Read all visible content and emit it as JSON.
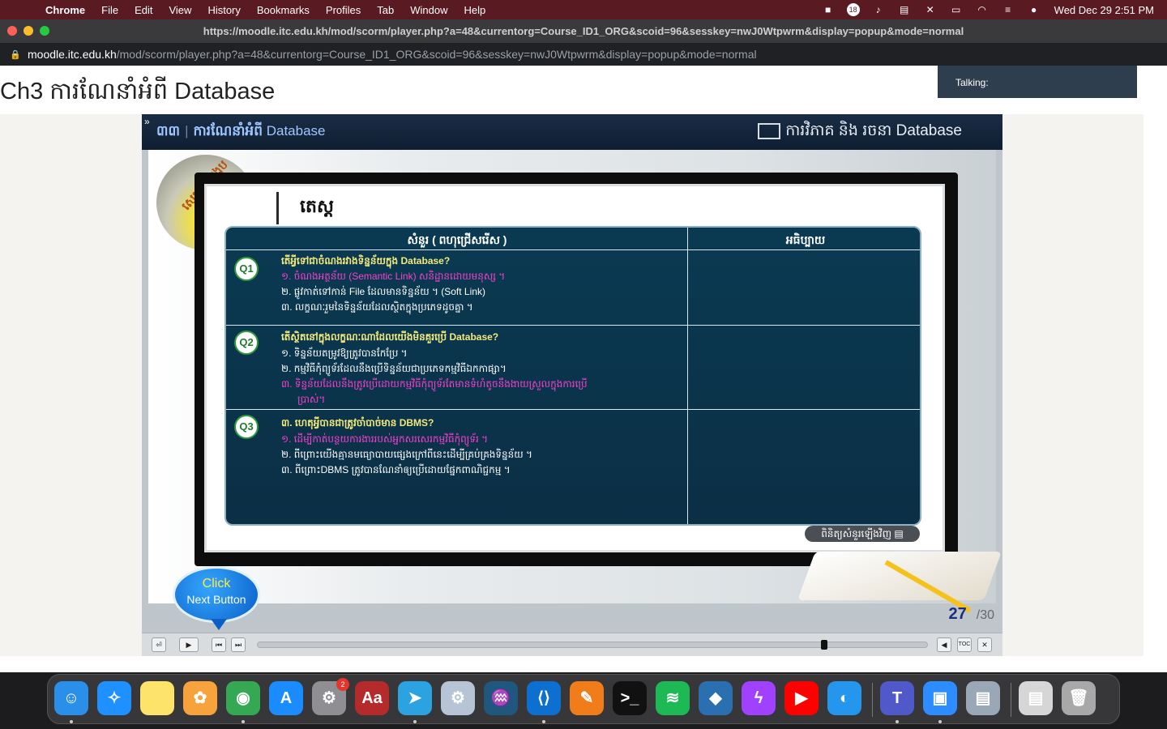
{
  "menubar": {
    "apple": "",
    "app": "Chrome",
    "items": [
      "File",
      "Edit",
      "View",
      "History",
      "Bookmarks",
      "Profiles",
      "Tab",
      "Window",
      "Help"
    ],
    "clock": "Wed Dec 29  2:51 PM",
    "status_icons": [
      "screen-record-icon",
      "notification-icon",
      "volume-icon",
      "flag-icon",
      "bluetooth-icon",
      "battery-icon",
      "wifi-icon",
      "control-center-icon",
      "siri-icon"
    ],
    "notification_count": "18"
  },
  "window": {
    "title_url": "https://moodle.itc.edu.kh/mod/scorm/player.php?a=48&currentorg=Course_ID1_ORG&scoid=96&sesskey=nwJ0Wtpwrm&display=popup&mode=normal"
  },
  "address": {
    "host": "moodle.itc.edu.kh",
    "path": "/mod/scorm/player.php?a=48&currentorg=Course_ID1_ORG&scoid=96&sesskey=nwJ0Wtpwrm&display=popup&mode=normal"
  },
  "page": {
    "title": "Ch3 ការណែនាំអំពី Database",
    "talking": "Talking:"
  },
  "player": {
    "expand": "»",
    "chapter": "៣៣",
    "chapter_title": "ការណែនាំអំពី",
    "chapter_db": "Database",
    "course": "ការវិភាគ និង រចនា Database",
    "lamp_label": "សេចក្តីសង្ខេប",
    "slide_heading": "តេស្ត",
    "col_question": "សំនួរ ( ពហុជ្រើសរើស )",
    "col_explain": "អធិប្បាយ",
    "questions": [
      {
        "badge": "Q1",
        "text": "តើអ្វីទៅជាចំណងរវាងទិន្នន័យក្នុង Database?",
        "options": [
          {
            "text": "១. ចំណងអត្ថន័យ (Semantic Link) សនិដ្ឋានដោយមនុស្ស ។",
            "color": "#ff3fd0"
          },
          {
            "text": "២. ផ្លូវកាត់ទៅកាន់ File ដែលមានទិន្នន័យ ។ (Soft Link)",
            "color": "#ffffff"
          },
          {
            "text": "៣. លក្ខណៈរួមនៃទិន្នន័យដែលស្ថិតក្នុងប្រភេទដូចគ្នា ។",
            "color": "#ffffff"
          }
        ]
      },
      {
        "badge": "Q2",
        "text": "តើស្ថិតនៅក្នុងលក្ខណៈណាដែលយើងមិនគួរប្រើ Database?",
        "options": [
          {
            "text": "១. ទិន្នន័យតម្រូវឱ្យត្រូវបានកែប្រែ ។",
            "color": "#ffffff"
          },
          {
            "text": "២. កម្មវិធីកុំព្យូទ័រដែលនឹងប្រើទិន្នន័យជាប្រភេទកម្មវិធីឯកកាផ្សា។",
            "color": "#ffffff"
          },
          {
            "text": "៣. ទិន្នន័យដែលនឹងត្រូវប្រើដោយកម្មវិធីកុំព្យូទ័រតែមានទំហំតូចនឹងងាយស្រួលក្នុងការប្រើ",
            "color": "#ff3fd0"
          },
          {
            "text": "ប្រាស់។",
            "color": "#ff3fd0"
          }
        ]
      },
      {
        "badge": "Q3",
        "text": "៣. ហេតុអ្វីបានជាត្រូវចាំបាច់មាន DBMS?",
        "options": [
          {
            "text": "១. ដើម្បីកាត់បន្ថយការងាររបស់អ្នកសរសេរកម្មវិធីកុំព្យូទ័រ ។",
            "color": "#ff3fd0"
          },
          {
            "text": "២. ពីព្រោះយើងគ្មានមធ្យោបាយផ្សេងក្រៅពីនេះដើម្បីគ្រប់គ្រងទិន្នន័យ ។",
            "color": "#ffffff"
          },
          {
            "text": "៣. ពីព្រោះDBMS ត្រូវបានណែនាំឲ្យប្រើដោយផ្នែកពាណិជ្ជកម្ម ។",
            "color": "#ffffff"
          }
        ]
      }
    ],
    "review_button": "ពិនិត្យសំនួរឡើងវិញ ▤",
    "click_label": "Click",
    "next_label": "Next Button",
    "page_current": "27",
    "page_total": "/30",
    "progress_fraction": 0.85,
    "controls": {
      "exit": "⏎",
      "play": "▶",
      "prev": "⏮",
      "next": "⏭",
      "volume": "◀",
      "toc": "TOC",
      "close": "✕"
    }
  },
  "dock": {
    "apps": [
      {
        "name": "finder",
        "glyph": "☺",
        "color": "#2a8fe8",
        "dot": true
      },
      {
        "name": "safari",
        "glyph": "✧",
        "color": "#1e90ff",
        "dot": false
      },
      {
        "name": "notes",
        "glyph": "",
        "color": "#fde36a",
        "dot": false
      },
      {
        "name": "photos",
        "glyph": "✿",
        "color": "#f7a23b",
        "dot": false
      },
      {
        "name": "chrome",
        "glyph": "◉",
        "color": "#34a853",
        "dot": true
      },
      {
        "name": "app-store",
        "glyph": "A",
        "color": "#1b8cff",
        "dot": false
      },
      {
        "name": "system-preferences",
        "glyph": "⚙",
        "color": "#8e8e93",
        "dot": false,
        "badge": "2"
      },
      {
        "name": "dictionary",
        "glyph": "Aa",
        "color": "#b52a2a",
        "dot": false
      },
      {
        "name": "telegram",
        "glyph": "➤",
        "color": "#2aa3e0",
        "dot": true
      },
      {
        "name": "settings-utility",
        "glyph": "⚙",
        "color": "#b6c4d6",
        "dot": false
      },
      {
        "name": "mysql-workbench",
        "glyph": "♒",
        "color": "#20577e",
        "dot": false
      },
      {
        "name": "vscode",
        "glyph": "⟨⟩",
        "color": "#0d6fd0",
        "dot": true
      },
      {
        "name": "pages",
        "glyph": "✎",
        "color": "#f07c1a",
        "dot": false
      },
      {
        "name": "terminal",
        "glyph": ">_",
        "color": "#111111",
        "dot": false
      },
      {
        "name": "spotify",
        "glyph": "≋",
        "color": "#1db954",
        "dot": false
      },
      {
        "name": "virtualbox",
        "glyph": "◆",
        "color": "#2a6fb0",
        "dot": false
      },
      {
        "name": "messenger",
        "glyph": "ϟ",
        "color": "#a041ff",
        "dot": false
      },
      {
        "name": "youtube",
        "glyph": "▶",
        "color": "#ff0000",
        "dot": false
      },
      {
        "name": "docker",
        "glyph": "◐",
        "color": "#2496ed",
        "dot": false
      },
      {
        "name": "teams",
        "glyph": "T",
        "color": "#5059c9",
        "dot": true
      },
      {
        "name": "zoom",
        "glyph": "▣",
        "color": "#2d8cff",
        "dot": true
      },
      {
        "name": "preview",
        "glyph": "▤",
        "color": "#9aa7b6",
        "dot": false
      },
      {
        "name": "documents",
        "glyph": "▤",
        "color": "#d6d6d6",
        "dot": false
      },
      {
        "name": "trash",
        "glyph": "🗑",
        "color": "#a8a8a8",
        "dot": false
      }
    ]
  }
}
